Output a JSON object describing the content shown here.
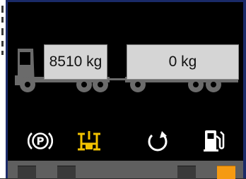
{
  "loads": {
    "front": "8510 kg",
    "rear": "0 kg"
  },
  "status_icons": [
    {
      "name": "parking-brake-icon",
      "color": "#ffffff"
    },
    {
      "name": "differential-lock-icon",
      "color": "#f2c200"
    },
    {
      "name": "regeneration-icon",
      "color": "#ffffff"
    },
    {
      "name": "fuel-pump-icon",
      "color": "#ffffff"
    }
  ],
  "colors": {
    "screen_background": "#000000",
    "vehicle": "#6b6b6b",
    "field": "#d5d5d5",
    "warning_amber": "#f2c200",
    "active_button": "#f59a12",
    "bezel_blue": "#1a2a68"
  },
  "buttons": [
    {
      "name": "softkey-1",
      "active": false
    },
    {
      "name": "softkey-2",
      "active": false
    },
    {
      "name": "softkey-3",
      "active": false
    },
    {
      "name": "softkey-4",
      "active": true
    }
  ]
}
